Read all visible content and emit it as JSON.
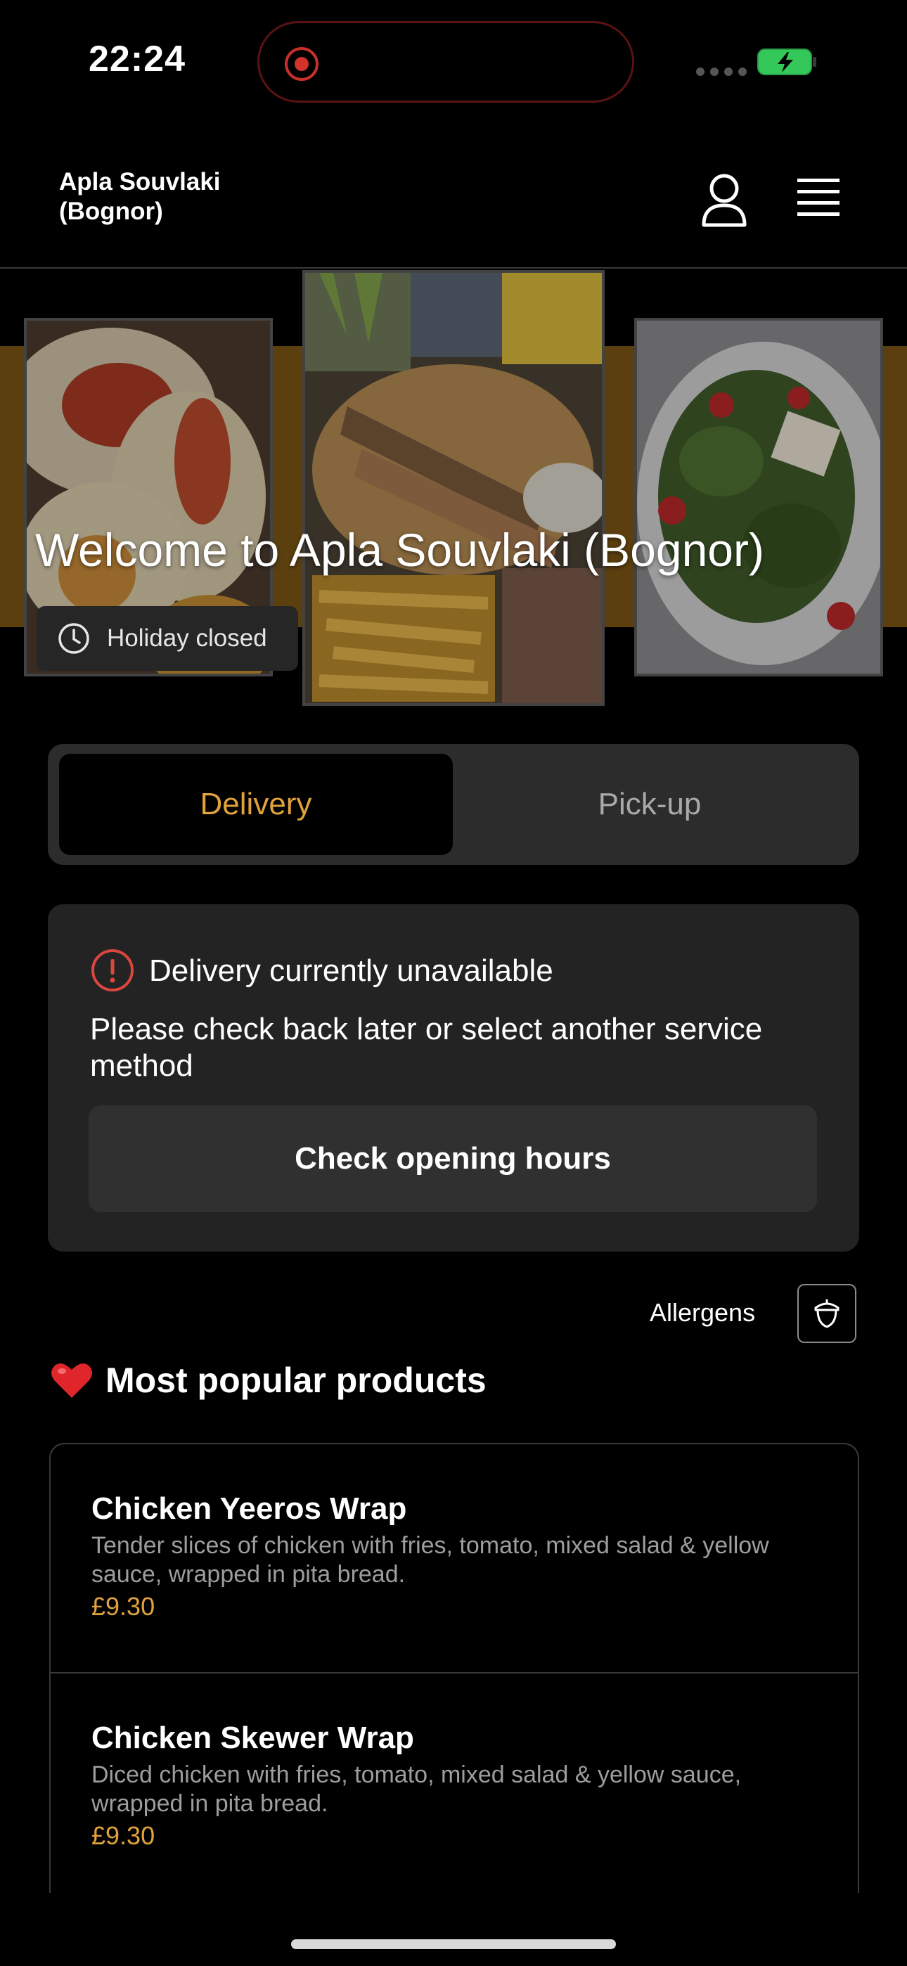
{
  "status_bar": {
    "time": "22:24"
  },
  "header": {
    "brand": "Apla Souvlaki (Bognor)"
  },
  "hero": {
    "title": "Welcome to Apla Souvlaki (Bognor)",
    "status": "Holiday closed"
  },
  "service_tabs": [
    {
      "label": "Delivery",
      "selected": true
    },
    {
      "label": "Pick-up",
      "selected": false
    }
  ],
  "notice": {
    "title": "Delivery currently unavailable",
    "text": "Please check back later or select another service method",
    "button": "Check opening hours"
  },
  "allergens": {
    "label": "Allergens"
  },
  "popular": {
    "heading": "Most popular products",
    "products": [
      {
        "name": "Chicken Yeeros Wrap",
        "description": "Tender slices of chicken with fries, tomato, mixed salad & yellow sauce, wrapped in pita bread.",
        "price": "£9.30"
      },
      {
        "name": "Chicken Skewer Wrap",
        "description": "Diced chicken with fries, tomato, mixed salad & yellow sauce, wrapped in pita bread.",
        "price": "£9.30"
      }
    ]
  },
  "colors": {
    "accent": "#e0a33c",
    "background": "#000000",
    "card": "#232323",
    "alert": "#d9473e"
  }
}
